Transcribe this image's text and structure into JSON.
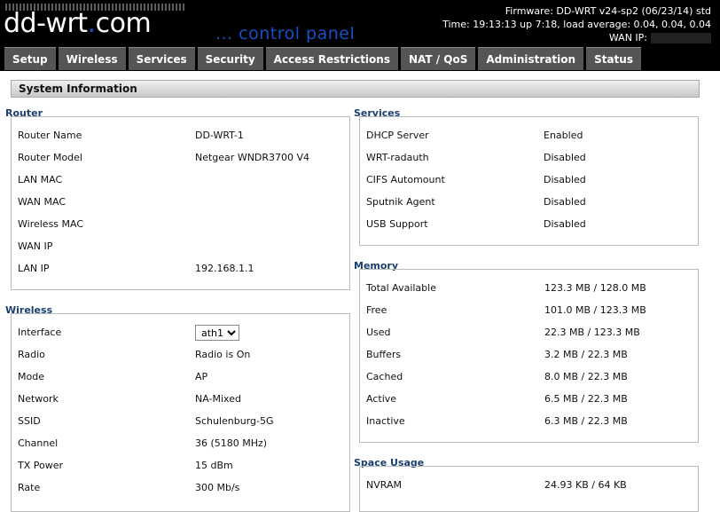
{
  "header": {
    "logo_main": "dd-wrt",
    "logo_dot": ".",
    "logo_com": "com",
    "subtitle": "... control panel",
    "firmware": "Firmware: DD-WRT v24-sp2 (06/23/14) std",
    "time": "Time: 19:13:13 up 7:18, load average: 0.04, 0.04, 0.04",
    "wan_ip_label": "WAN IP:"
  },
  "tabs": [
    {
      "label": "Setup"
    },
    {
      "label": "Wireless"
    },
    {
      "label": "Services"
    },
    {
      "label": "Security"
    },
    {
      "label": "Access Restrictions"
    },
    {
      "label": "NAT / QoS"
    },
    {
      "label": "Administration"
    },
    {
      "label": "Status"
    }
  ],
  "section_title": "System Information",
  "router": {
    "legend": "Router",
    "rows": [
      {
        "label": "Router Name",
        "value": "DD-WRT-1"
      },
      {
        "label": "Router Model",
        "value": "Netgear WNDR3700 V4"
      },
      {
        "label": "LAN MAC",
        "value": ""
      },
      {
        "label": "WAN MAC",
        "value": ""
      },
      {
        "label": "Wireless MAC",
        "value": ""
      },
      {
        "label": "WAN IP",
        "value": ""
      },
      {
        "label": "LAN IP",
        "value": "192.168.1.1"
      }
    ]
  },
  "wireless": {
    "legend": "Wireless",
    "interface_label": "Interface",
    "interface_value": "ath1",
    "rows": [
      {
        "label": "Radio",
        "value": "Radio is On"
      },
      {
        "label": "Mode",
        "value": "AP"
      },
      {
        "label": "Network",
        "value": "NA-Mixed"
      },
      {
        "label": "SSID",
        "value": "Schulenburg-5G"
      },
      {
        "label": "Channel",
        "value": "36 (5180 MHz)"
      },
      {
        "label": "TX Power",
        "value": "15 dBm"
      },
      {
        "label": "Rate",
        "value": "300 Mb/s"
      }
    ]
  },
  "services": {
    "legend": "Services",
    "rows": [
      {
        "label": "DHCP Server",
        "value": "Enabled"
      },
      {
        "label": "WRT-radauth",
        "value": "Disabled"
      },
      {
        "label": "CIFS Automount",
        "value": "Disabled"
      },
      {
        "label": "Sputnik Agent",
        "value": "Disabled"
      },
      {
        "label": "USB Support",
        "value": "Disabled"
      }
    ]
  },
  "memory": {
    "legend": "Memory",
    "rows": [
      {
        "label": "Total Available",
        "value": "123.3 MB / 128.0 MB"
      },
      {
        "label": "Free",
        "value": "101.0 MB / 123.3 MB"
      },
      {
        "label": "Used",
        "value": "22.3 MB / 123.3 MB"
      },
      {
        "label": "Buffers",
        "value": "3.2 MB / 22.3 MB"
      },
      {
        "label": "Cached",
        "value": "8.0 MB / 22.3 MB"
      },
      {
        "label": "Active",
        "value": "6.5 MB / 22.3 MB"
      },
      {
        "label": "Inactive",
        "value": "6.3 MB / 22.3 MB"
      }
    ]
  },
  "space_usage": {
    "legend": "Space Usage",
    "rows": [
      {
        "label": "NVRAM",
        "value": "24.93 KB / 64 KB"
      }
    ]
  },
  "colors": {
    "header_bg": "#000000",
    "tab_bg": "#555555",
    "legend_text": "#1a4070",
    "logo_accent": "#1a4fc4"
  }
}
